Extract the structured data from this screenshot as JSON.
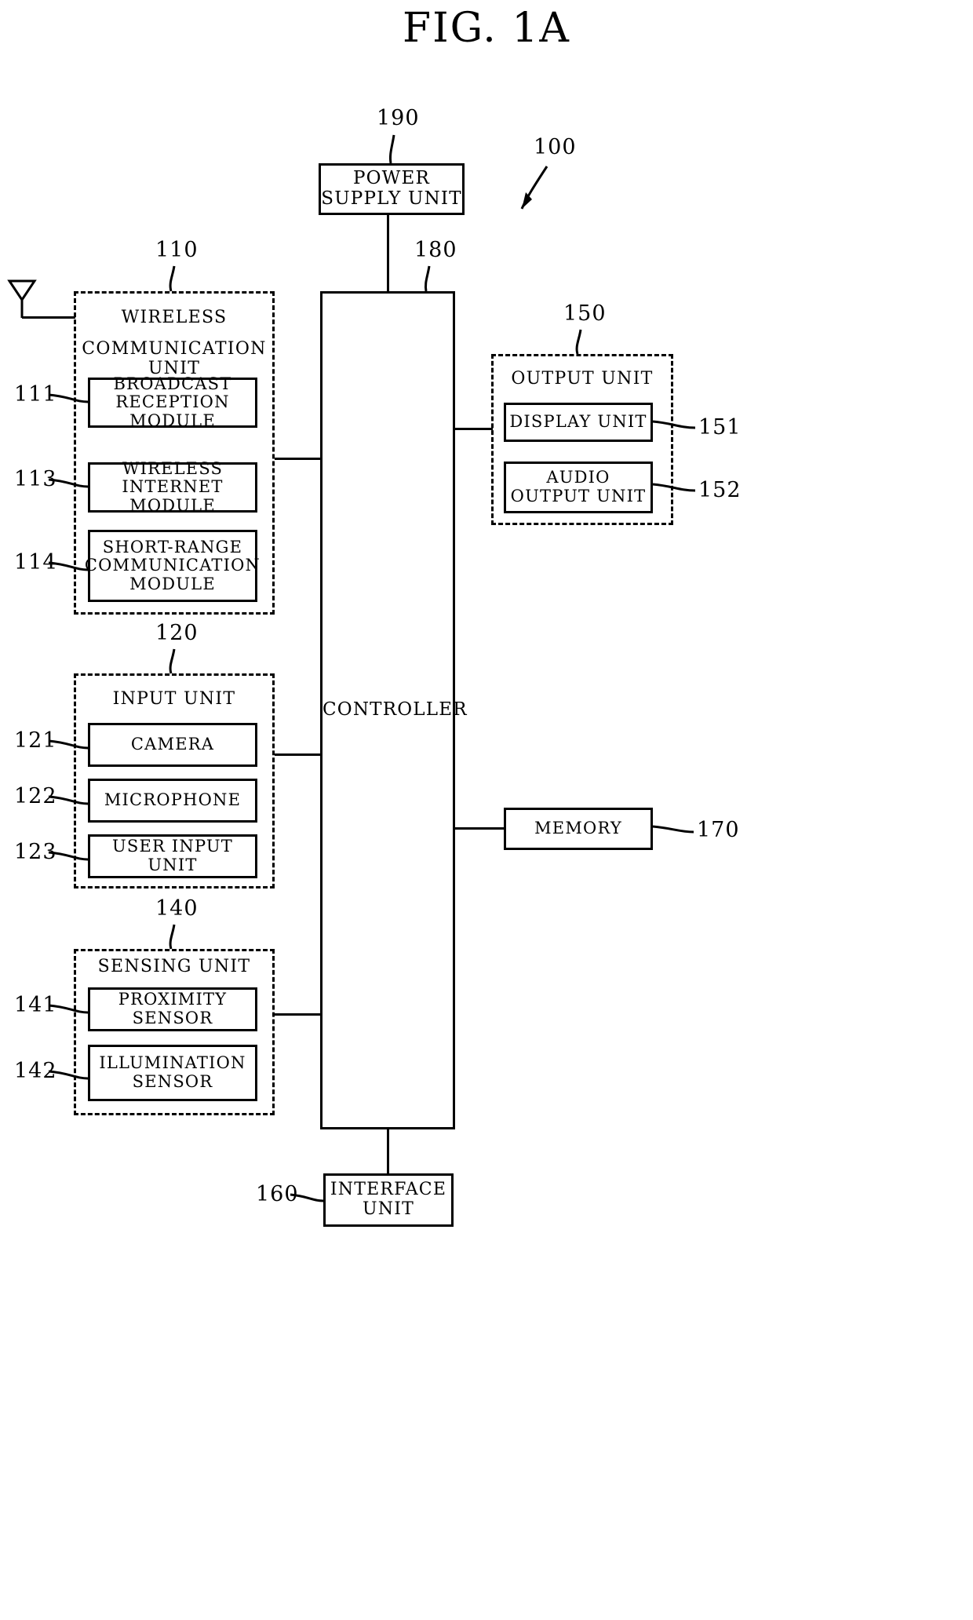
{
  "figure": {
    "title": "FIG. 1A",
    "system_ref": "100"
  },
  "blocks": {
    "power_supply": {
      "label": "POWER\nSUPPLY UNIT",
      "line1": "POWER",
      "line2": "SUPPLY UNIT",
      "ref": "190"
    },
    "controller": {
      "label": "CONTROLLER",
      "ref": "180"
    },
    "memory": {
      "label": "MEMORY",
      "ref": "170"
    },
    "interface": {
      "line1": "INTERFACE",
      "line2": "UNIT",
      "ref": "160"
    }
  },
  "wireless_unit": {
    "title_line1": "WIRELESS",
    "title_line2": "COMMUNICATION UNIT",
    "ref": "110",
    "modules": [
      {
        "ref": "111",
        "line1": "BROADCAST",
        "line2": "RECEPTION MODULE",
        "line3": ""
      },
      {
        "ref": "113",
        "line1": "WIRELESS",
        "line2": "INTERNET MODULE",
        "line3": ""
      },
      {
        "ref": "114",
        "line1": "SHORT-RANGE",
        "line2": "COMMUNICATION",
        "line3": "MODULE"
      }
    ]
  },
  "input_unit": {
    "title": "INPUT UNIT",
    "ref": "120",
    "modules": [
      {
        "ref": "121",
        "label": "CAMERA"
      },
      {
        "ref": "122",
        "label": "MICROPHONE"
      },
      {
        "ref": "123",
        "label": "USER INPUT UNIT"
      }
    ]
  },
  "sensing_unit": {
    "title": "SENSING UNIT",
    "ref": "140",
    "modules": [
      {
        "ref": "141",
        "line1": "PROXIMITY SENSOR",
        "line2": ""
      },
      {
        "ref": "142",
        "line1": "ILLUMINATION",
        "line2": "SENSOR"
      }
    ]
  },
  "output_unit": {
    "title": "OUTPUT UNIT",
    "ref": "150",
    "modules": [
      {
        "ref": "151",
        "line1": "DISPLAY UNIT",
        "line2": ""
      },
      {
        "ref": "152",
        "line1": "AUDIO",
        "line2": "OUTPUT UNIT"
      }
    ]
  },
  "colors": {
    "ink": "#000000",
    "paper": "#ffffff"
  }
}
